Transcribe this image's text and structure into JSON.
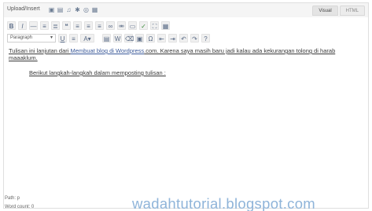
{
  "upload": {
    "label": "Upload/Insert",
    "icons": [
      "image-icon",
      "video-icon",
      "audio-icon",
      "media-icon",
      "gallery-icon",
      "form-icon"
    ]
  },
  "modes": {
    "visual": "Visual",
    "html": "HTML"
  },
  "toolbar": {
    "row1": [
      "bold-icon",
      "italic-icon",
      "strikethrough-icon",
      "bullet-list-icon",
      "numbered-list-icon",
      "blockquote-icon",
      "align-left-icon",
      "align-center-icon",
      "align-right-icon",
      "link-icon",
      "unlink-icon",
      "more-tag-icon",
      "spellcheck-icon",
      "fullscreen-icon",
      "kitchen-sink-icon"
    ],
    "format_value": "Paragraph",
    "row2": [
      "underline-icon",
      "justify-icon",
      "text-color-icon",
      "paste-text-icon",
      "paste-word-icon",
      "remove-format-icon",
      "media-embed-icon",
      "special-char-icon",
      "outdent-icon",
      "indent-icon",
      "undo-icon",
      "redo-icon",
      "help-icon"
    ]
  },
  "content": {
    "p1_start": "Tulisan ini lanjutan dari ",
    "p1_link": "Membuat blog di Wordpress",
    "p1_end": ".com. Karena saya masih baru jadi kalau ada kekurangan tolong di harab maaaklum.",
    "p2": "Berikut langkah-langkah dalam memposting tulisan :"
  },
  "status": {
    "path": "Path: p",
    "word_count": "Word count: 0"
  },
  "watermark": "wadahtutorial.blogspot.com"
}
